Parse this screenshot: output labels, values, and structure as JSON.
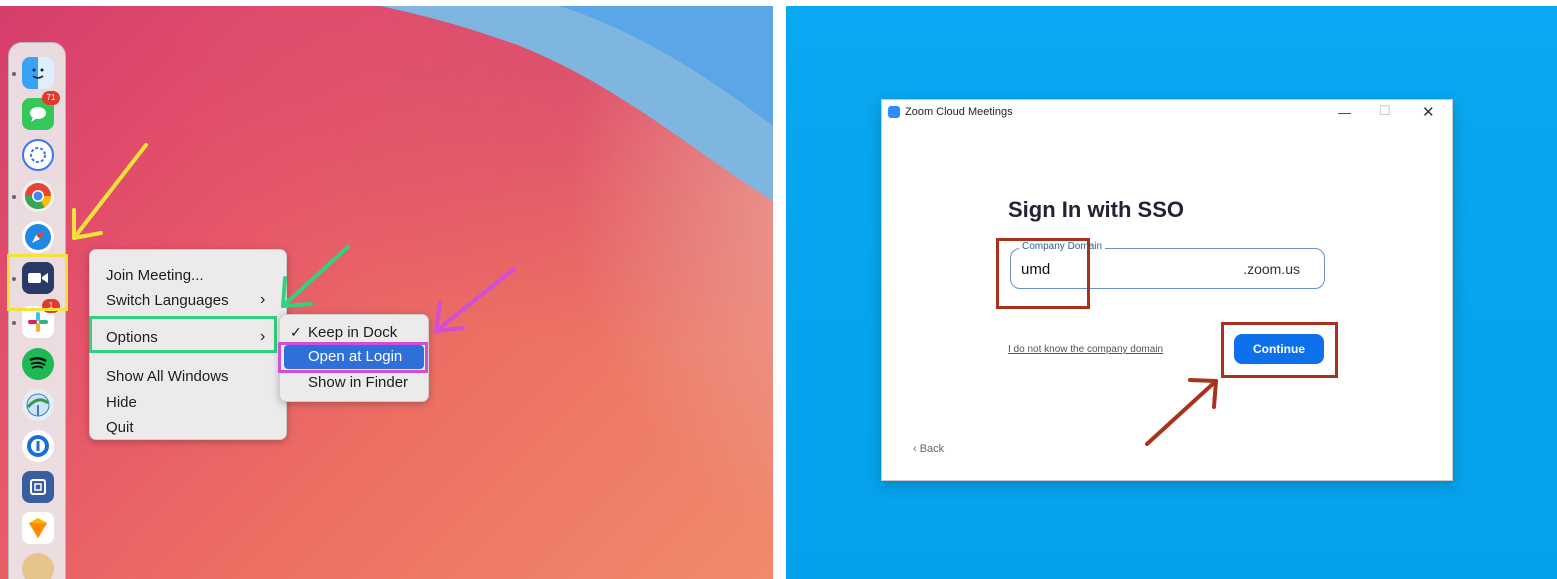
{
  "dock": {
    "items": [
      {
        "name": "finder-icon",
        "color": "#2f9cf0"
      },
      {
        "name": "messages-icon",
        "color": "#34c759",
        "badge": "71"
      },
      {
        "name": "signal-icon",
        "color": "#3a76f0"
      },
      {
        "name": "chrome-icon",
        "color": "#ea4335"
      },
      {
        "name": "safari-icon",
        "color": "#1e88e5"
      },
      {
        "name": "zoom-icon",
        "color": "#2d8cff"
      },
      {
        "name": "slack-icon",
        "color": "#e01e5a",
        "badge": "1"
      },
      {
        "name": "spotify-icon",
        "color": "#1db954"
      },
      {
        "name": "network-icon",
        "color": "#4caf50"
      },
      {
        "name": "onepassword-icon",
        "color": "#1a6fd6"
      },
      {
        "name": "screen-app-icon",
        "color": "#3a5fa0"
      },
      {
        "name": "sketch-icon",
        "color": "#f7b500"
      },
      {
        "name": "app-icon",
        "color": "#d9a45a"
      }
    ]
  },
  "context_menu": {
    "items": [
      "Join Meeting...",
      "Switch Languages",
      "Options",
      "Show All Windows",
      "Hide",
      "Quit"
    ]
  },
  "options_submenu": {
    "check": "✓",
    "items": [
      "Keep in Dock",
      "Open at Login",
      "Show in Finder"
    ]
  },
  "zoom": {
    "window_title": "Zoom Cloud Meetings",
    "heading": "Sign In with SSO",
    "field_label": "Company Domain",
    "field_value": "umd",
    "field_suffix": ".zoom.us",
    "link_text": "I do not know the company domain",
    "continue_label": "Continue",
    "back_label": "‹ Back",
    "minimize": "—",
    "maximize": "☐",
    "close": "✕"
  },
  "colors": {
    "yellow": "#f3e23b",
    "green": "#2fd27f",
    "magenta": "#d14ed6",
    "red": "#a8321c",
    "selection": "#2f6fd9",
    "zoom_blue": "#0e71eb"
  }
}
